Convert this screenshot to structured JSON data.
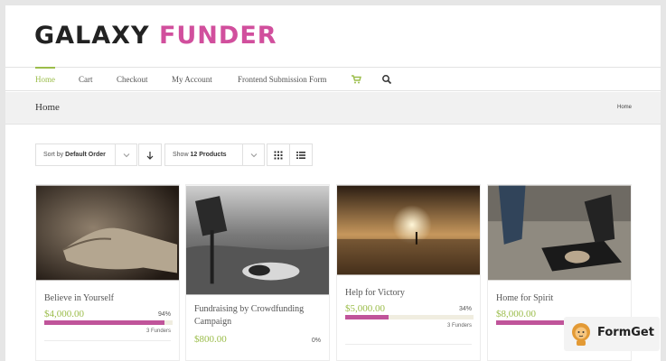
{
  "brand": {
    "part1": "GALAXY",
    "part2": "FUNDER"
  },
  "nav": {
    "items": [
      "Home",
      "Cart",
      "Checkout",
      "My Account",
      "Frontend Submission Form"
    ],
    "icons": [
      "cart-icon",
      "search-icon"
    ],
    "accent": "#9bbd4a"
  },
  "page": {
    "title": "Home",
    "breadcrumb": "Home"
  },
  "toolbar": {
    "sort_prefix": "Sort by",
    "sort_value": "Default Order",
    "show_prefix": "Show",
    "show_value": "12 Products",
    "icons": [
      "sort-direction-icon",
      "grid-view-icon",
      "list-view-icon"
    ]
  },
  "products": [
    {
      "title": "Believe in Yourself",
      "price": "$4,000.00",
      "percent_label": "94%",
      "percent": 94,
      "funders": "3 Funders"
    },
    {
      "title": "Fundraising by Crowdfunding Campaign",
      "price": "$800.00",
      "percent_label": "0%",
      "percent": 0,
      "funders": ""
    },
    {
      "title": "Help for Victory",
      "price": "$5,000.00",
      "percent_label": "34%",
      "percent": 34,
      "funders": "3 Funders"
    },
    {
      "title": "Home for Spirit",
      "price": "$8,000.00",
      "percent_label": "",
      "percent": 100,
      "funders": ""
    }
  ],
  "colors": {
    "brand_pink": "#d14f9d",
    "price_green": "#9bbd4a",
    "progress_fill": "#c0549a",
    "progress_track": "#f0ede0"
  },
  "badge": {
    "text": "FormGet"
  }
}
